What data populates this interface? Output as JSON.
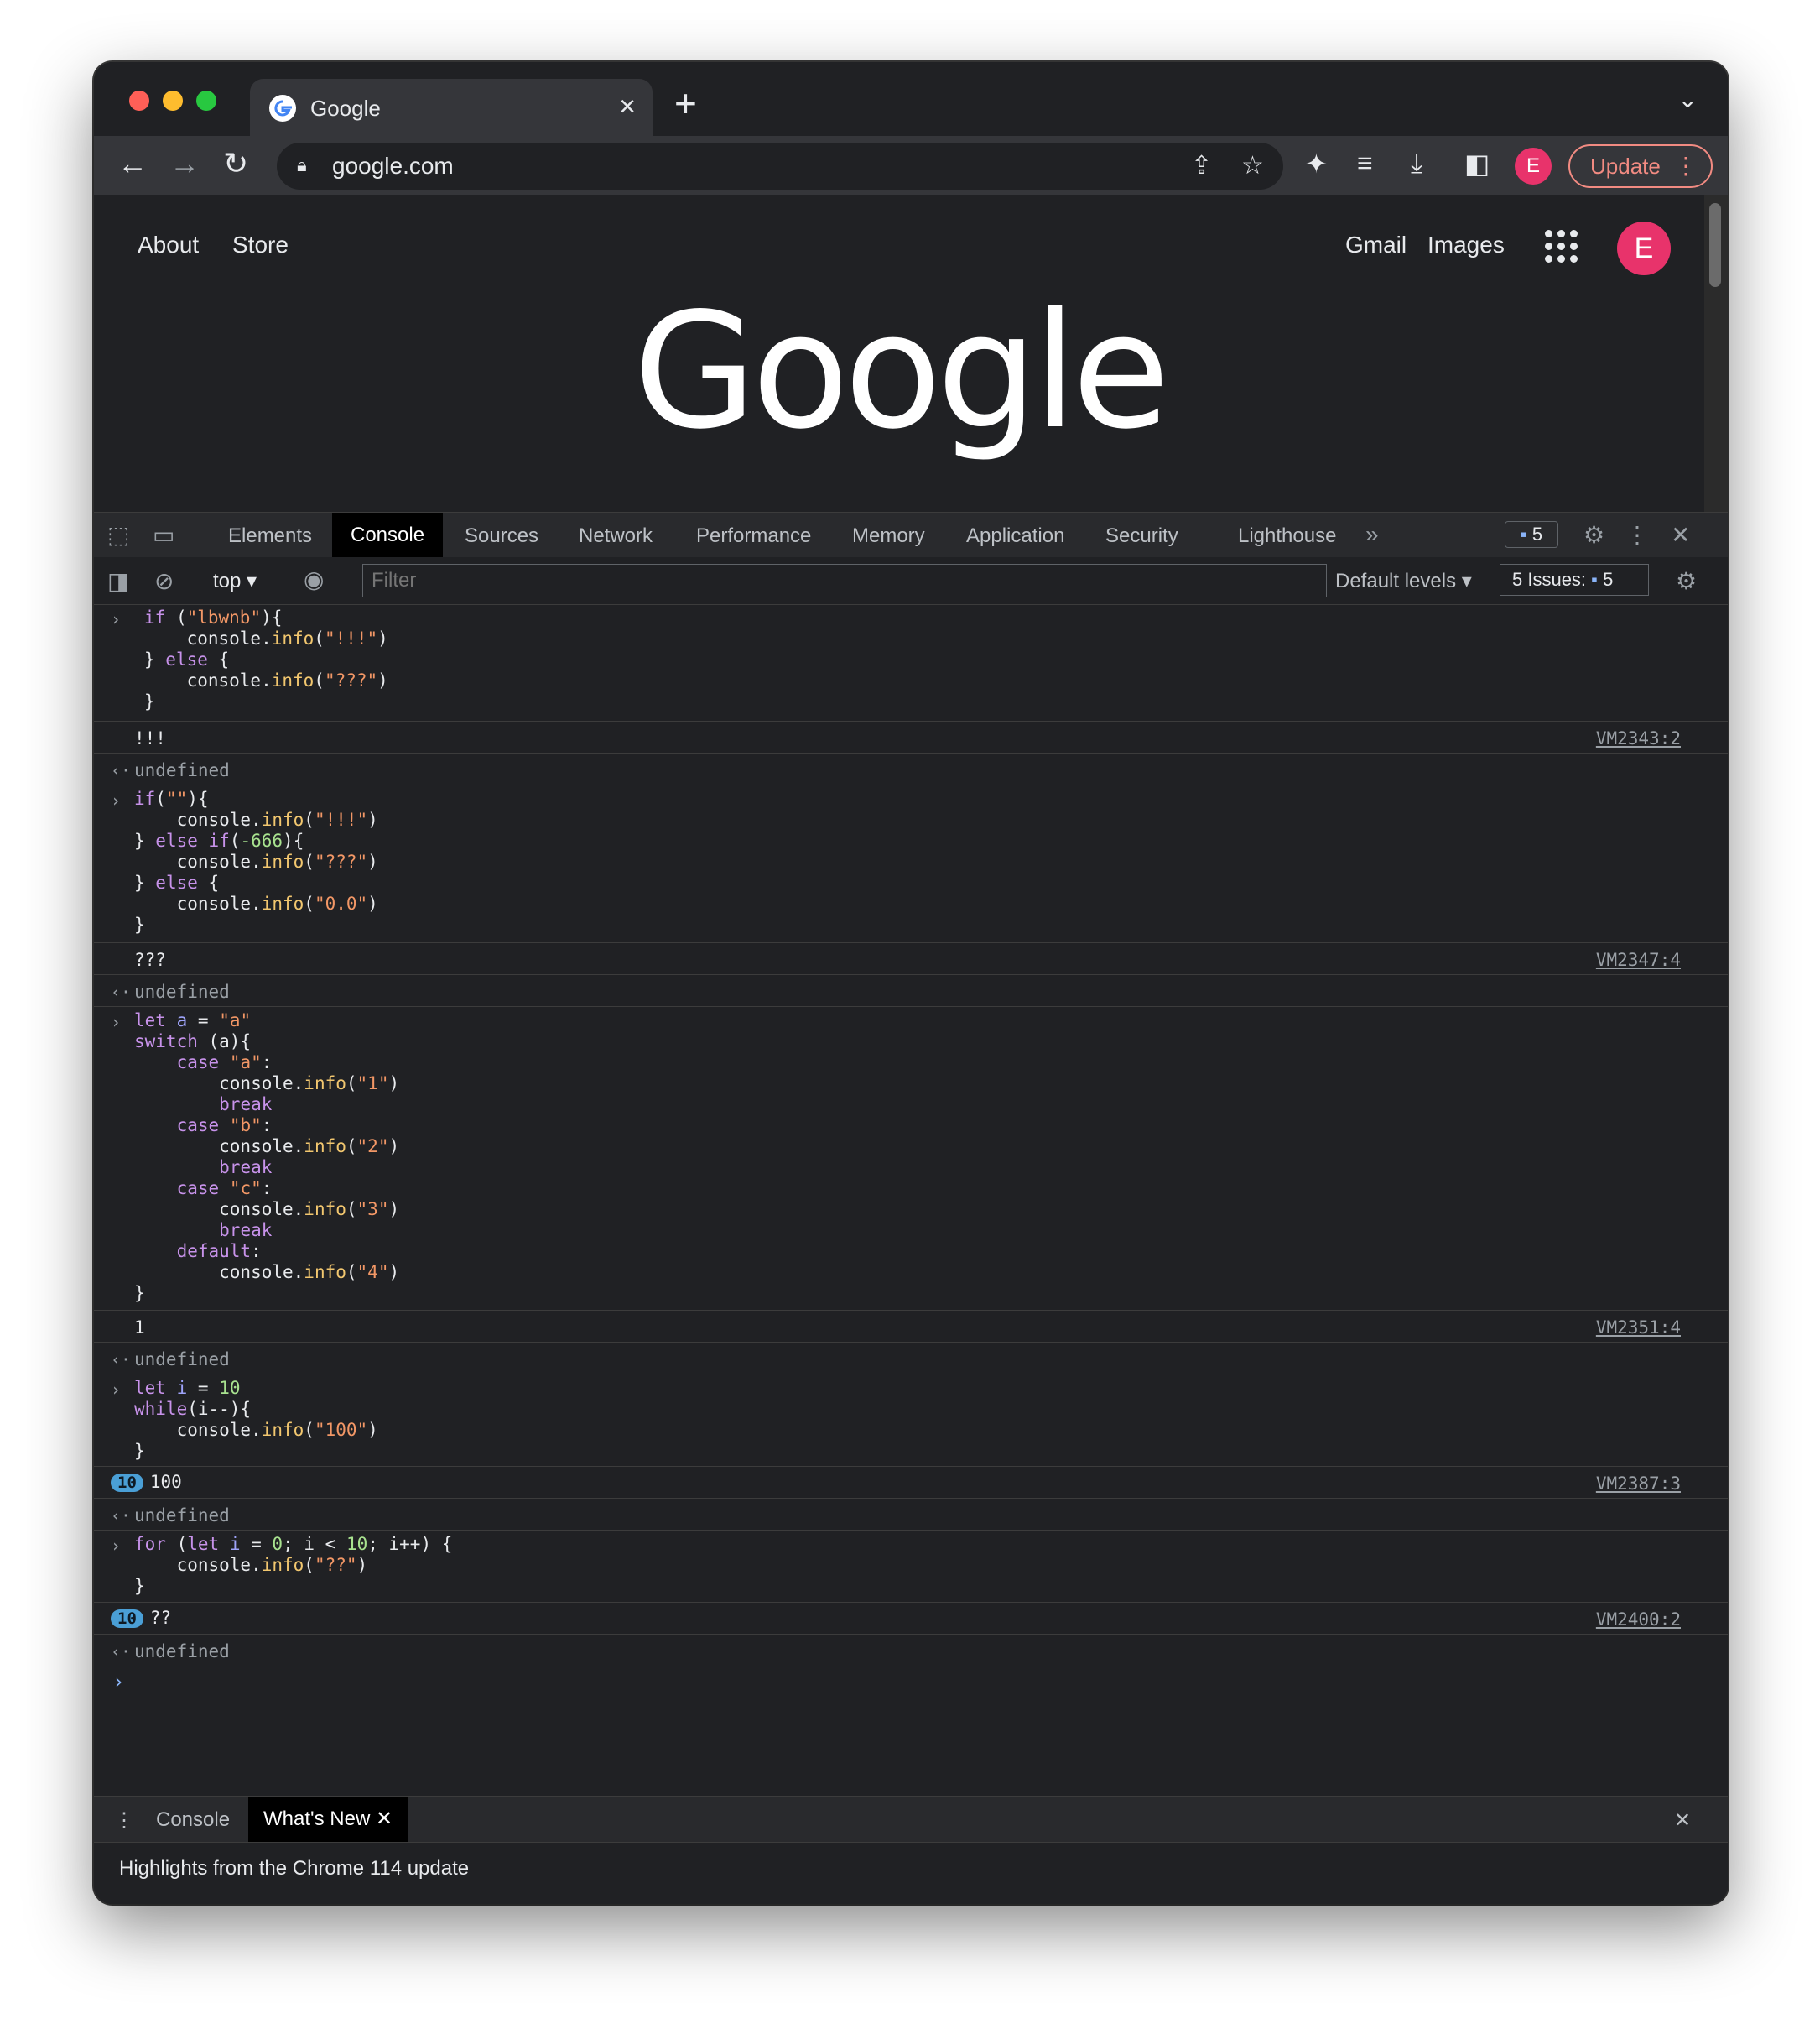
{
  "browser": {
    "tab_title": "Google",
    "url": "google.com",
    "update_label": "Update",
    "profile_initial": "E"
  },
  "page": {
    "links_left": [
      "About",
      "Store"
    ],
    "links_right": [
      "Gmail",
      "Images"
    ],
    "logo_text": "Google",
    "avatar_initial": "E"
  },
  "devtools": {
    "tabs": [
      "Elements",
      "Console",
      "Sources",
      "Network",
      "Performance",
      "Memory",
      "Application",
      "Security",
      "Lighthouse"
    ],
    "active_tab": "Console",
    "messages_count": "5",
    "context": "top",
    "filter_placeholder": "Filter",
    "levels": "Default levels",
    "issues_label": "5 Issues:",
    "issues_count": "5"
  },
  "console": {
    "entries": [
      {
        "code": "if (\"lbwnb\"){\n    console.info(\"!!!\")\n} else {\n    console.info(\"???\")\n}",
        "output": "!!!",
        "source": "VM2343:2",
        "result": "undefined"
      },
      {
        "code": "if(\"\"){\n    console.info(\"!!!\")\n} else if(-666){\n    console.info(\"???\")\n} else {\n    console.info(\"0.0\")\n}",
        "output": "???",
        "source": "VM2347:4",
        "result": "undefined"
      },
      {
        "code": "let a = \"a\"\nswitch (a){\n    case \"a\":\n        console.info(\"1\")\n        break\n    case \"b\":\n        console.info(\"2\")\n        break\n    case \"c\":\n        console.info(\"3\")\n        break\n    default:\n        console.info(\"4\")\n}",
        "output": "1",
        "source": "VM2351:4",
        "result": "undefined"
      },
      {
        "code": "let i = 10\nwhile(i--){\n    console.info(\"100\")\n}",
        "output": "100",
        "repeat": "10",
        "source": "VM2387:3",
        "result": "undefined"
      },
      {
        "code": "for (let i = 0; i < 10; i++) {\n    console.info(\"??\")\n}",
        "output": "??",
        "repeat": "10",
        "source": "VM2400:2",
        "result": "undefined"
      }
    ]
  },
  "drawer": {
    "tabs": [
      "Console",
      "What's New"
    ],
    "active_tab": "What's New",
    "highlight": "Highlights from the Chrome 114 update"
  }
}
